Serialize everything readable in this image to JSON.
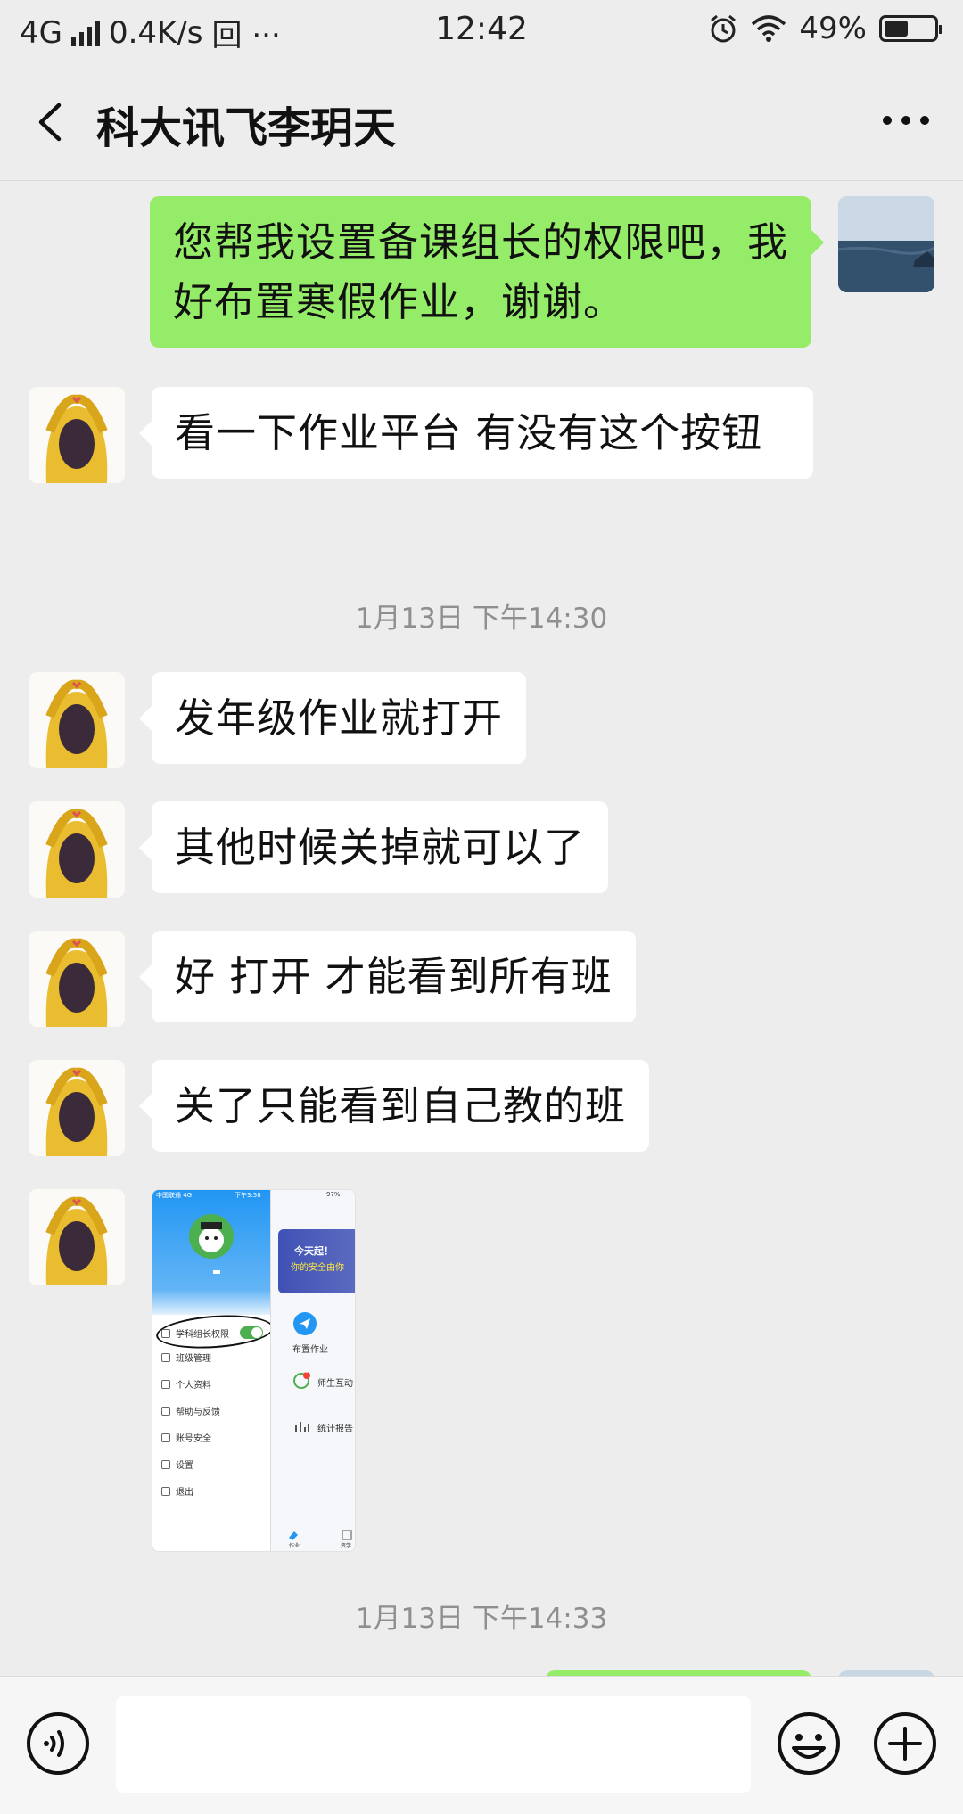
{
  "status_bar": {
    "network": "4G",
    "speed": "0.4K/s",
    "extra_icons": "回 ···",
    "time": "12:42",
    "battery": "49%",
    "battery_level": 0.49
  },
  "header": {
    "title": "科大讯飞李玥天"
  },
  "messages": [
    {
      "sender": "self",
      "text": "您帮我设置备课组长的权限吧，我好布置寒假作业，谢谢。"
    },
    {
      "sender": "other",
      "text": "看一下作业平台 有没有这个按钮"
    },
    {
      "type": "time",
      "text": "1月13日 下午14:30"
    },
    {
      "sender": "other",
      "text": "发年级作业就打开"
    },
    {
      "sender": "other",
      "text": "其他时候关掉就可以了"
    },
    {
      "sender": "other",
      "text": "好 打开 才能看到所有班"
    },
    {
      "sender": "other",
      "text": "关了只能看到自己教的班"
    },
    {
      "type": "time",
      "text": "1月13日 下午14:33"
    }
  ],
  "shared_image": {
    "status_carrier": "中国联通 4G",
    "status_time": "下午3:58",
    "status_battery": "97%",
    "menu": [
      "学科组长权限",
      "班级管理",
      "个人资料",
      "帮助与反馈",
      "账号安全",
      "设置",
      "退出"
    ],
    "banner_line1": "今天起！",
    "banner_line2": "你的安全由你",
    "actions": [
      "布置作业",
      "师生互动",
      "统计报告"
    ],
    "bottom_tabs": [
      "作业",
      "资学"
    ],
    "badge": "1"
  },
  "input_bar": {
    "placeholder": ""
  }
}
